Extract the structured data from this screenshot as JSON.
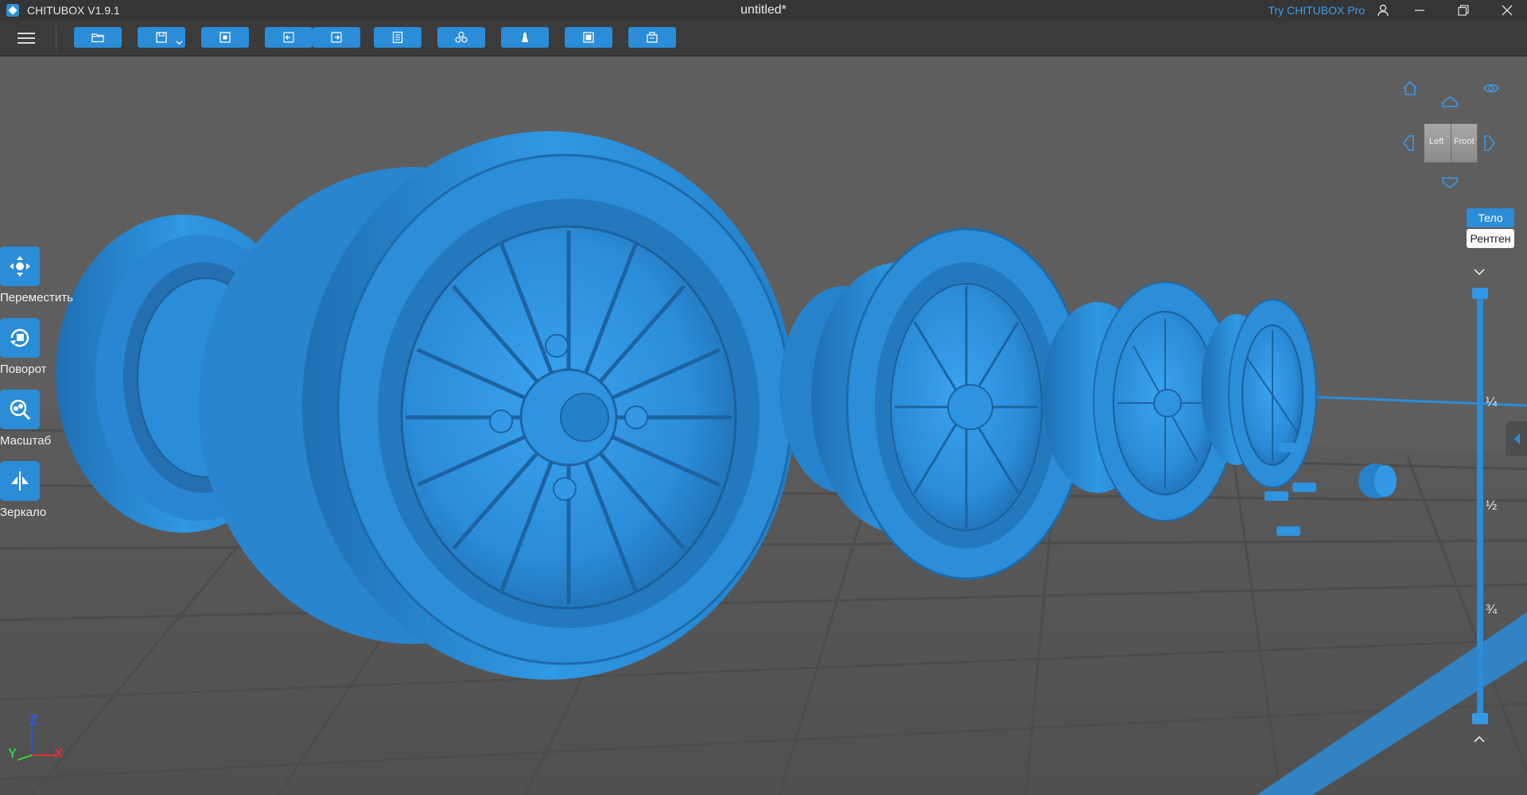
{
  "app": {
    "name": "CHITUBOX V1.9.1",
    "document_title": "untitled*",
    "try_pro": "Try CHITUBOX Pro"
  },
  "colors": {
    "accent": "#2b8cd8",
    "model": "#2f8fdb",
    "background": "#5e5e5e",
    "grid": "#4a4a4a",
    "link": "#3aa0f0"
  },
  "toolbar": {
    "buttons": [
      {
        "icon": "open-folder-icon"
      },
      {
        "icon": "save-icon",
        "has_dropdown": true
      },
      {
        "icon": "select-frame-icon"
      },
      {
        "icon": "undo-icon"
      },
      {
        "icon": "redo-icon"
      },
      {
        "icon": "settings-list-icon"
      },
      {
        "icon": "multi-models-icon"
      },
      {
        "icon": "support-icon"
      },
      {
        "icon": "slice-icon"
      },
      {
        "icon": "print-icon"
      }
    ]
  },
  "left_tools": [
    {
      "label": "Переместить",
      "icon": "move-icon"
    },
    {
      "label": "Поворот",
      "icon": "rotate-icon"
    },
    {
      "label": "Масштаб",
      "icon": "scale-icon"
    },
    {
      "label": "Зеркало",
      "icon": "mirror-icon"
    }
  ],
  "nav_cube": {
    "left_label": "Left",
    "front_label": "Front"
  },
  "view_modes": {
    "body": "Тело",
    "xray": "Рентген"
  },
  "layer_slider": {
    "marks": [
      "¼",
      "½",
      "¾"
    ],
    "top_value": 1,
    "bottom_value": 0
  },
  "axes": {
    "x": "X",
    "y": "Y",
    "z": "Z"
  }
}
